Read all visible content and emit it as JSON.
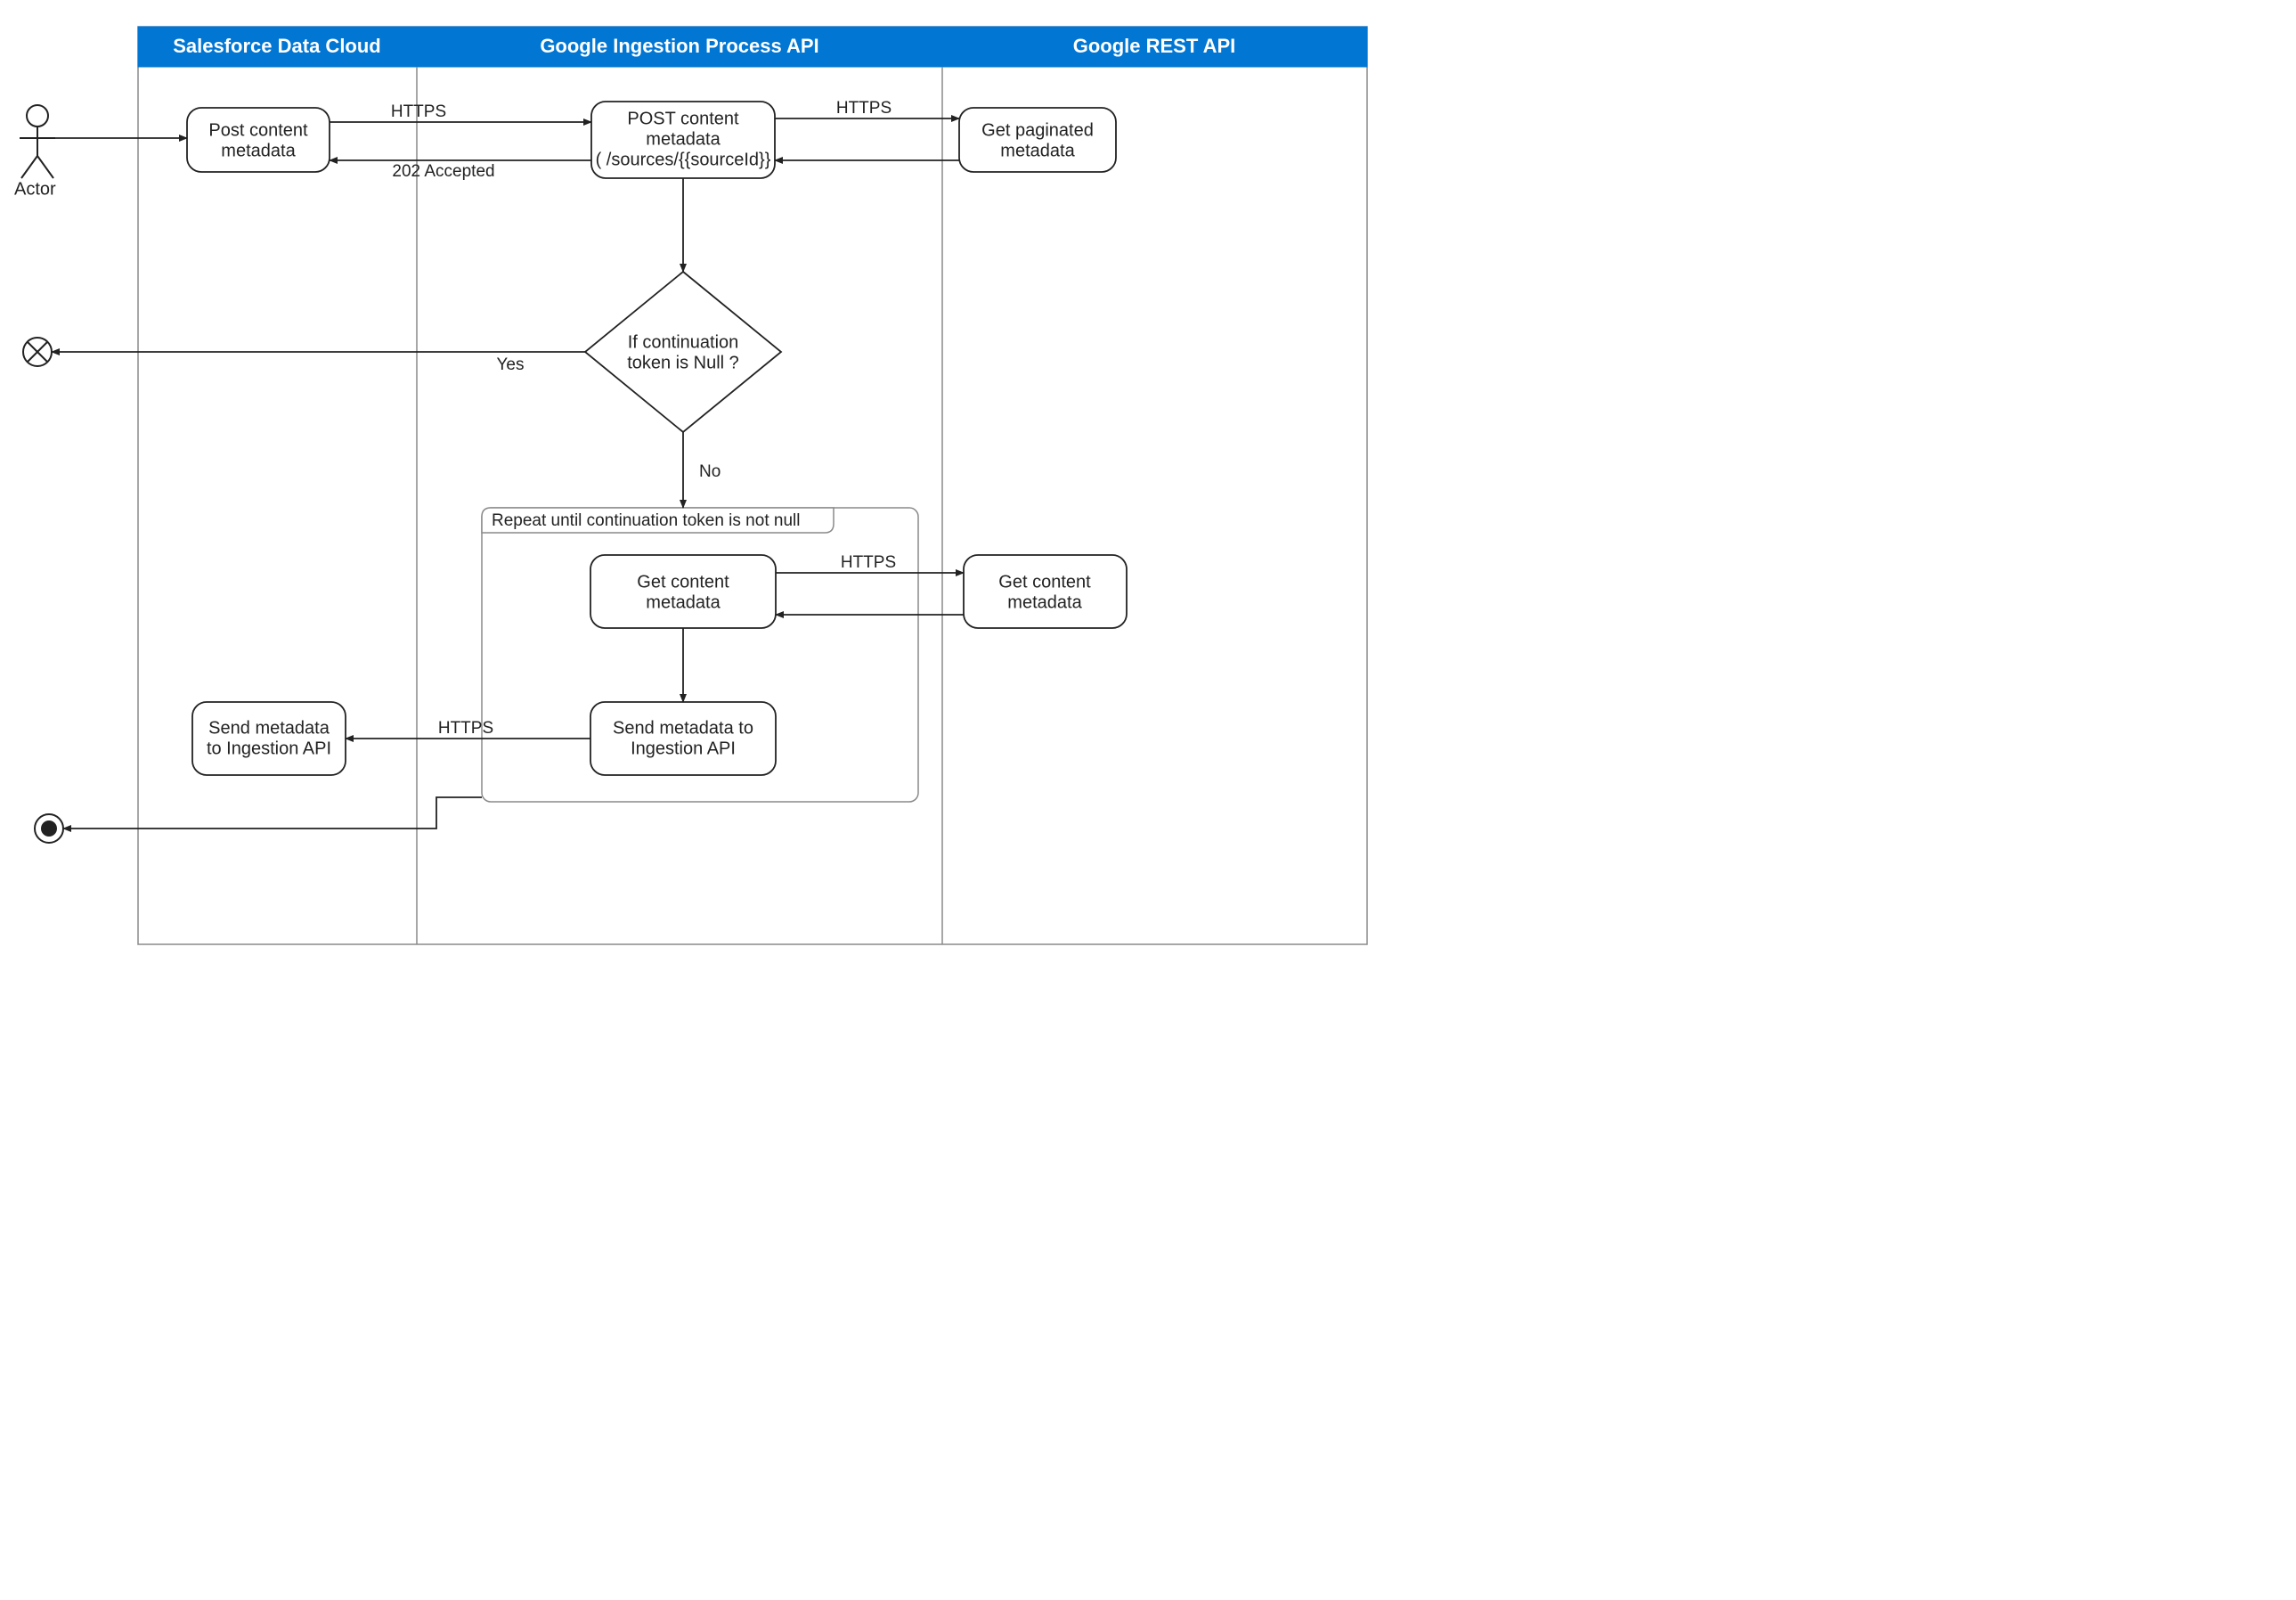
{
  "actor": {
    "label": "Actor"
  },
  "lanes": {
    "salesforce": {
      "title": "Salesforce Data Cloud"
    },
    "process": {
      "title": "Google Ingestion Process API"
    },
    "rest": {
      "title": "Google REST API"
    }
  },
  "nodes": {
    "post_content_meta_sf": {
      "line1": "Post content",
      "line2": "metadata"
    },
    "post_content_meta_proc": {
      "line1": "POST content",
      "line2": "metadata",
      "line3": "( /sources/{{sourceId}}"
    },
    "get_paginated_meta": {
      "line1": "Get paginated",
      "line2": "metadata"
    },
    "decision": {
      "line1": "If continuation",
      "line2": "token is Null ?"
    },
    "get_content_meta_loop": {
      "line1": "Get content",
      "line2": "metadata"
    },
    "get_content_meta_rest": {
      "line1": "Get content",
      "line2": "metadata"
    },
    "send_meta_loop": {
      "line1": "Send metadata to",
      "line2": "Ingestion API"
    },
    "send_meta_sf": {
      "line1": "Send metadata",
      "line2": "to Ingestion API"
    }
  },
  "loop": {
    "title": "Repeat until continuation token is not null"
  },
  "edgeLabels": {
    "https1": "HTTPS",
    "accepted": "202 Accepted",
    "https2": "HTTPS",
    "yes": "Yes",
    "no": "No",
    "https3": "HTTPS",
    "https4": "HTTPS"
  }
}
